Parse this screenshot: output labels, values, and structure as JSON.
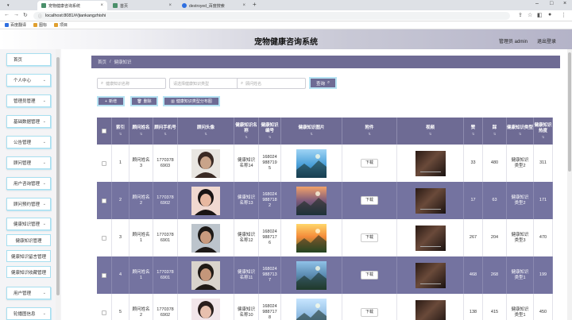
{
  "browser": {
    "tabs": [
      {
        "title": "宠物健康咨询系统",
        "active": true
      },
      {
        "title": "首页",
        "active": false
      },
      {
        "title": "destroyed_百度搜索",
        "active": false
      }
    ],
    "address": "localhost:8081/#/jiankangzhishi",
    "bookmarks": [
      "百度翻译",
      "图标",
      "项目"
    ]
  },
  "header": {
    "title": "宠物健康咨询系统",
    "user": "管理员 admin",
    "logout": "退出登录"
  },
  "sidebar": {
    "items": [
      {
        "label": "首页",
        "chevron": false
      },
      {
        "label": "个人中心",
        "chevron": true
      },
      {
        "label": "管理员管理",
        "chevron": true
      },
      {
        "label": "基础数据管理",
        "chevron": true
      },
      {
        "label": "公告管理",
        "chevron": true
      },
      {
        "label": "顾问管理",
        "chevron": true
      },
      {
        "label": "用户咨询管理",
        "chevron": true
      },
      {
        "label": "顾问预约管理",
        "chevron": true
      },
      {
        "label": "健康知识管理",
        "chevron": true
      }
    ],
    "subitems": [
      "健康知识管理",
      "健康知识留言管理",
      "健康知识收藏管理"
    ],
    "tail_items": [
      {
        "label": "用户管理",
        "chevron": true
      },
      {
        "label": "轮播图信息",
        "chevron": true
      }
    ]
  },
  "breadcrumb": {
    "home": "首页",
    "sep": "/",
    "current": "健康知识"
  },
  "search": {
    "name_placeholder": "健康知识名称",
    "type_placeholder": "请选择健康知识类型",
    "advisor_placeholder": "顾问姓名",
    "query_label": "查询"
  },
  "actions": {
    "add": "新增",
    "delete": "删除",
    "report": "健康知识类型分布图"
  },
  "table": {
    "columns": [
      "",
      "索引",
      "顾问姓名",
      "顾问手机号",
      "顾问头像",
      "健康知识名称",
      "健康知识编号",
      "健康知识图片",
      "附件",
      "视频",
      "赞",
      "踩",
      "健康知识类型",
      "健康知识热度"
    ],
    "download_label": "下载",
    "rows": [
      {
        "index": "1",
        "name": "顾问姓名3",
        "phone": "17703786903",
        "title": "健康知识名称14",
        "code": "1680249887195",
        "like": "33",
        "dislike": "480",
        "type": "健康知识类型2",
        "heat": "311"
      },
      {
        "index": "2",
        "name": "顾问姓名2",
        "phone": "17703786902",
        "title": "健康知识名称13",
        "code": "1680249887182",
        "like": "17",
        "dislike": "63",
        "type": "健康知识类型2",
        "heat": "171"
      },
      {
        "index": "3",
        "name": "顾问姓名1",
        "phone": "17703786901",
        "title": "健康知识名称12",
        "code": "1680249887176",
        "like": "267",
        "dislike": "204",
        "type": "健康知识类型3",
        "heat": "470"
      },
      {
        "index": "4",
        "name": "顾问姓名1",
        "phone": "17703786901",
        "title": "健康知识名称11",
        "code": "1680249887137",
        "like": "468",
        "dislike": "268",
        "type": "健康知识类型1",
        "heat": "199"
      },
      {
        "index": "5",
        "name": "顾问姓名2",
        "phone": "17703786902",
        "title": "健康知识名称10",
        "code": "1680249887178",
        "like": "138",
        "dislike": "415",
        "type": "健康知识类型1",
        "heat": "450"
      }
    ]
  },
  "colors": {
    "accent": "#6e6b94",
    "border": "#b6e3f3",
    "row_alt": "#7473a0"
  }
}
